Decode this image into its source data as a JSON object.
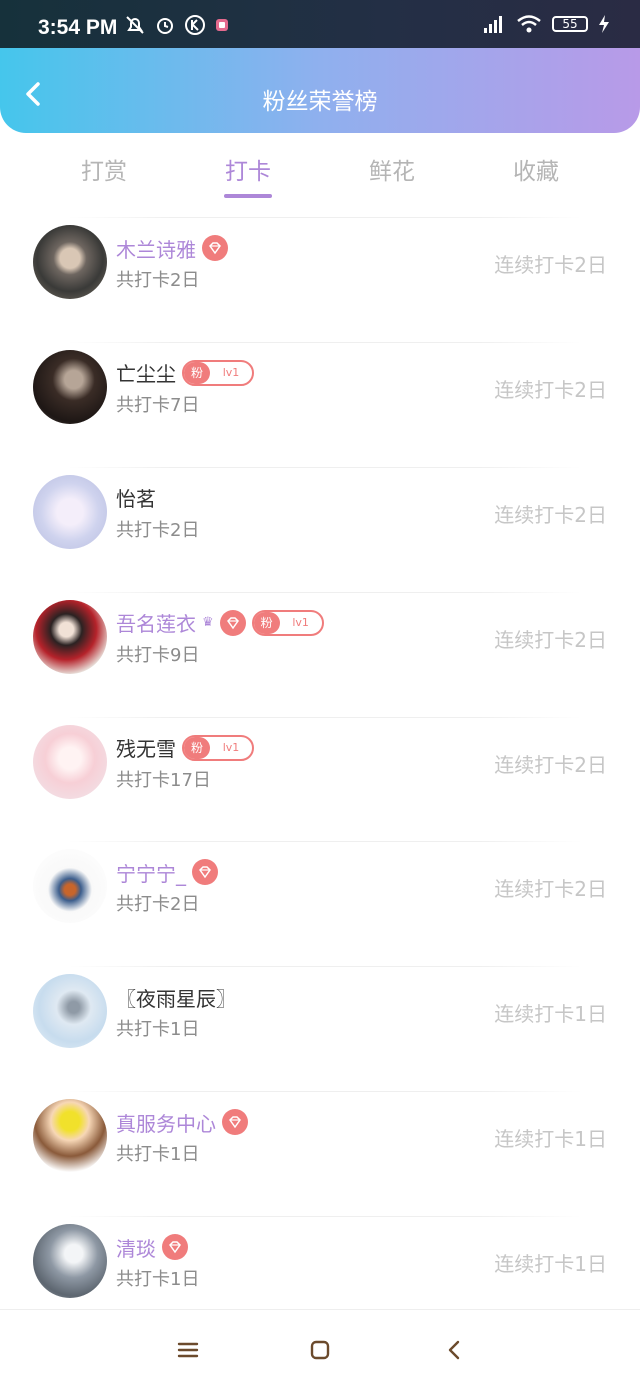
{
  "status_bar": {
    "time": "3:54 PM",
    "battery": "55"
  },
  "header": {
    "title": "粉丝荣誉榜"
  },
  "tabs": [
    {
      "label": "打赏",
      "active": false
    },
    {
      "label": "打卡",
      "active": true
    },
    {
      "label": "鲜花",
      "active": false
    },
    {
      "label": "收藏",
      "active": false
    }
  ],
  "list": [
    {
      "name": "木兰诗雅",
      "vip": true,
      "gem": true,
      "fan": false,
      "crown": false,
      "total": "共打卡2日",
      "streak": "连续打卡2日"
    },
    {
      "name": "亡尘尘",
      "vip": false,
      "gem": false,
      "fan": true,
      "crown": false,
      "total": "共打卡7日",
      "streak": "连续打卡2日"
    },
    {
      "name": "怡茗",
      "vip": false,
      "gem": false,
      "fan": false,
      "crown": false,
      "total": "共打卡2日",
      "streak": "连续打卡2日"
    },
    {
      "name": "吾名莲衣",
      "vip": true,
      "gem": true,
      "fan": true,
      "crown": true,
      "total": "共打卡9日",
      "streak": "连续打卡2日"
    },
    {
      "name": "残无雪",
      "vip": false,
      "gem": false,
      "fan": true,
      "crown": false,
      "total": "共打卡17日",
      "streak": "连续打卡2日"
    },
    {
      "name": "宁宁宁_",
      "vip": true,
      "gem": true,
      "fan": false,
      "crown": false,
      "total": "共打卡2日",
      "streak": "连续打卡2日"
    },
    {
      "name": "〖夜雨星辰〗",
      "vip": false,
      "gem": false,
      "fan": false,
      "crown": false,
      "total": "共打卡1日",
      "streak": "连续打卡1日"
    },
    {
      "name": "真服务中心",
      "vip": true,
      "gem": true,
      "fan": false,
      "crown": false,
      "total": "共打卡1日",
      "streak": "连续打卡1日"
    },
    {
      "name": "清琰",
      "vip": true,
      "gem": true,
      "fan": false,
      "crown": false,
      "total": "共打卡1日",
      "streak": "连续打卡1日"
    }
  ],
  "badge": {
    "fan_label": "粉",
    "fan_level": "lv1"
  },
  "icons": {
    "back": "chevron-left-icon",
    "gem": "diamond-icon",
    "nav_menu": "menu-icon",
    "nav_home": "square-icon",
    "nav_back": "back-icon"
  },
  "colors": {
    "header_gradient_start": "#45c6ec",
    "header_gradient_end": "#b89ae8",
    "accent": "#ad87d8",
    "badge": "#f07c7c"
  }
}
